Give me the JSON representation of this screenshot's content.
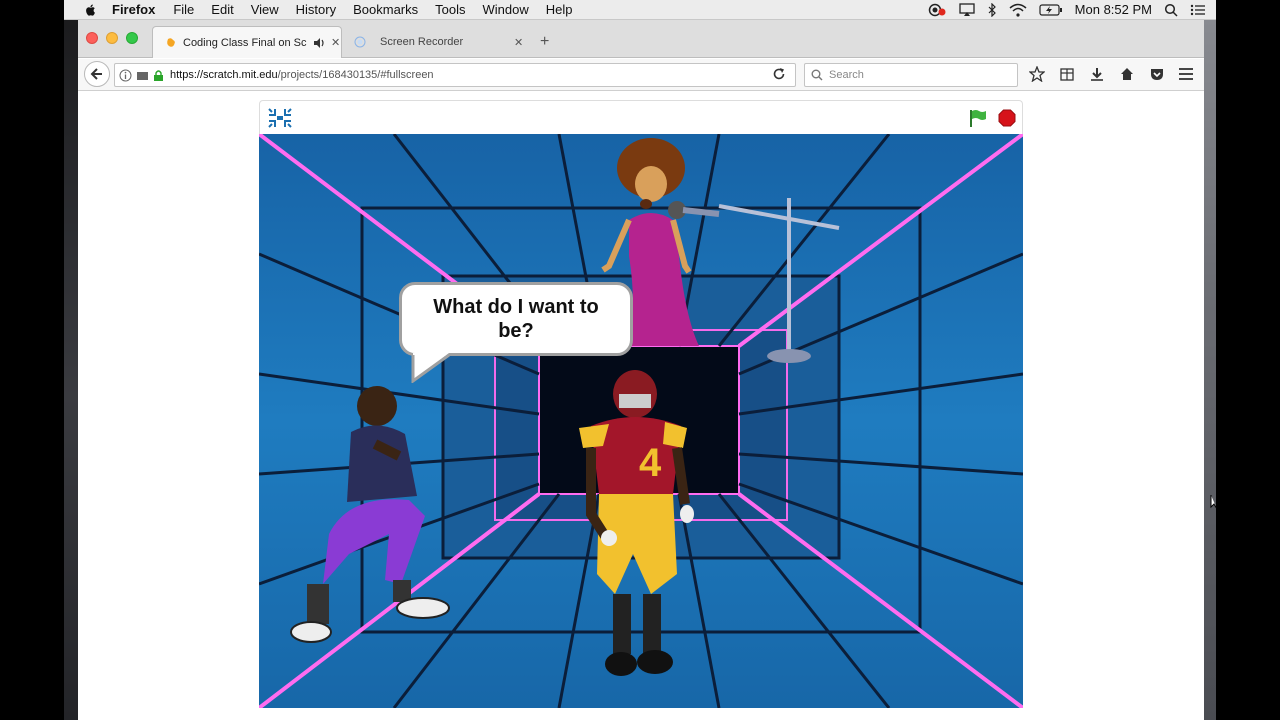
{
  "menubar": {
    "app_name": "Firefox",
    "items": [
      "File",
      "Edit",
      "View",
      "History",
      "Bookmarks",
      "Tools",
      "Window",
      "Help"
    ],
    "clock": "Mon 8:52 PM"
  },
  "tabs": [
    {
      "label": "Coding Class Final on Scr",
      "active": true
    },
    {
      "label": "Screen Recorder",
      "active": false
    }
  ],
  "navbar": {
    "url_host": "https://scratch.mit.edu",
    "url_rest": "/projects/168430135/#fullscreen",
    "search_placeholder": "Search"
  },
  "stage": {
    "speech_bubble": "What do I want to be?"
  },
  "colors": {
    "stage_blue": "#1a6fb0",
    "neon_pink": "#ff6cf0",
    "flag_green": "#3fb33f",
    "stop_red": "#d6131a"
  }
}
